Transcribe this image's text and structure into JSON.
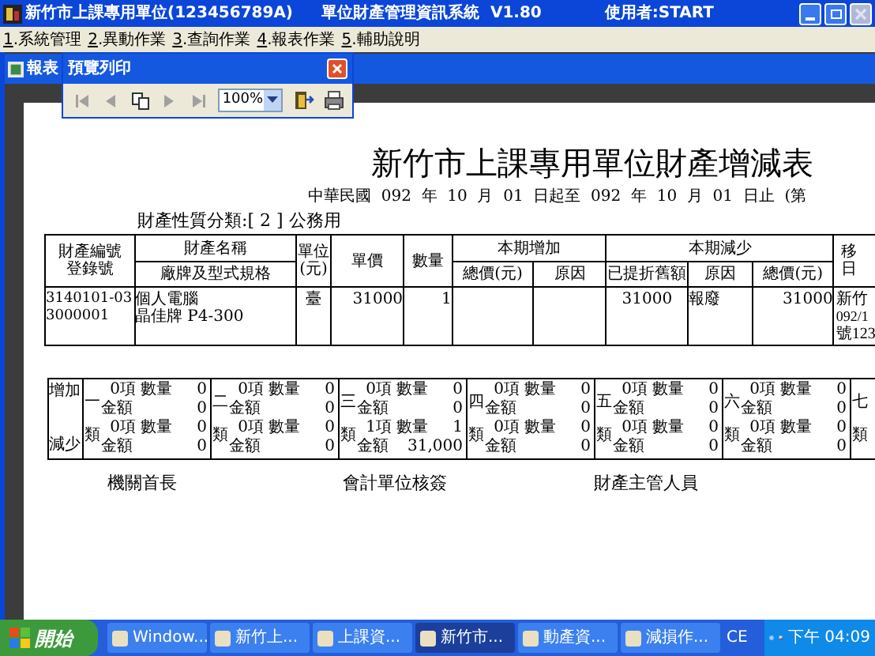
{
  "window": {
    "app_name": "新竹市上課專用單位(123456789A)",
    "system_name": "單位財產管理資訊系統  V1.80",
    "user": "使用者:START",
    "close_disabled": true
  },
  "menu": [
    {
      "key": "1",
      "label": ".系統管理"
    },
    {
      "key": "2",
      "label": ".異動作業"
    },
    {
      "key": "3",
      "label": ".查詢作業"
    },
    {
      "key": "4",
      "label": ".報表作業"
    },
    {
      "key": "5",
      "label": ".輔助說明"
    }
  ],
  "child_window": {
    "title": "報表"
  },
  "preview_toolbar": {
    "title": "預覽列印",
    "zoom": "100%",
    "buttons": [
      {
        "kind": "first",
        "disabled": true
      },
      {
        "kind": "prev",
        "disabled": true
      },
      {
        "kind": "copy",
        "disabled": false
      },
      {
        "kind": "next",
        "disabled": true
      },
      {
        "kind": "last",
        "disabled": true
      }
    ]
  },
  "report": {
    "title": "新竹市上課專用單位財產增減表",
    "period": "中華民國  092  年  10  月  01  日起至  092  年  10  月  01  日止  (第",
    "category": "財產性質分類:[ 2 ] 公務用",
    "headers": {
      "number": [
        "財產編號",
        "登錄號"
      ],
      "name": "財產名稱",
      "spec": "廠牌及型式規格",
      "unit": [
        "單位",
        "(元)"
      ],
      "price": "單價",
      "qty": "數量",
      "increase": "本期增加",
      "inc_total": "總價(元)",
      "inc_reason": "原因",
      "decrease": "本期減少",
      "depreciation": "已提折舊額",
      "dec_reason": "原因",
      "dec_total": "總價(元)",
      "last": [
        "移",
        "日"
      ]
    },
    "rows": [
      {
        "number": [
          "3140101-03",
          "3000001"
        ],
        "name": "個人電腦",
        "spec": "晶佳牌 P4-300",
        "unit": "臺",
        "price": "31000",
        "qty": "1",
        "inc_total": "",
        "inc_reason": "",
        "depreciation": "31000",
        "dec_reason": "報廢",
        "dec_total": "31000",
        "last": [
          "新竹",
          "092/1",
          "號123"
        ]
      }
    ],
    "summary": {
      "row_labels": [
        "增加",
        "減少"
      ],
      "groups": [
        {
          "numeral": "一",
          "suffix": "類",
          "increase": {
            "count": "0項",
            "qty_label": "數量",
            "qty": "0",
            "amount_label": "金額",
            "amount": "0"
          },
          "decrease": {
            "count": "0項",
            "qty_label": "數量",
            "qty": "0",
            "amount_label": "金額",
            "amount": "0"
          }
        },
        {
          "numeral": "二",
          "suffix": "類",
          "increase": {
            "count": "0項",
            "qty_label": "數量",
            "qty": "0",
            "amount_label": "金額",
            "amount": "0"
          },
          "decrease": {
            "count": "0項",
            "qty_label": "數量",
            "qty": "0",
            "amount_label": "金額",
            "amount": "0"
          }
        },
        {
          "numeral": "三",
          "suffix": "類",
          "increase": {
            "count": "0項",
            "qty_label": "數量",
            "qty": "0",
            "amount_label": "金額",
            "amount": "0"
          },
          "decrease": {
            "count": "1項",
            "qty_label": "數量",
            "qty": "1",
            "amount_label": "金額",
            "amount": "31,000"
          }
        },
        {
          "numeral": "四",
          "suffix": "類",
          "increase": {
            "count": "0項",
            "qty_label": "數量",
            "qty": "0",
            "amount_label": "金額",
            "amount": "0"
          },
          "decrease": {
            "count": "0項",
            "qty_label": "數量",
            "qty": "0",
            "amount_label": "金額",
            "amount": "0"
          }
        },
        {
          "numeral": "五",
          "suffix": "類",
          "increase": {
            "count": "0項",
            "qty_label": "數量",
            "qty": "0",
            "amount_label": "金額",
            "amount": "0"
          },
          "decrease": {
            "count": "0項",
            "qty_label": "數量",
            "qty": "0",
            "amount_label": "金額",
            "amount": "0"
          }
        },
        {
          "numeral": "六",
          "suffix": "類",
          "increase": {
            "count": "0項",
            "qty_label": "數量",
            "qty": "0",
            "amount_label": "金額",
            "amount": "0"
          },
          "decrease": {
            "count": "0項",
            "qty_label": "數量",
            "qty": "0",
            "amount_label": "金額",
            "amount": "0"
          }
        },
        {
          "numeral": "七",
          "suffix": "類"
        }
      ]
    },
    "signatures": [
      "機關首長",
      "會計單位核簽",
      "財產主管人員"
    ]
  },
  "taskbar": {
    "start": "開始",
    "items": [
      {
        "label": "Window...",
        "selected": false
      },
      {
        "label": "新竹上...",
        "selected": false
      },
      {
        "label": "上課資...",
        "selected": false
      },
      {
        "label": "新竹市...",
        "selected": true
      },
      {
        "label": "動產資...",
        "selected": false
      },
      {
        "label": "減損作...",
        "selected": false
      }
    ],
    "language": "CE",
    "clock": "下午 04:09"
  }
}
